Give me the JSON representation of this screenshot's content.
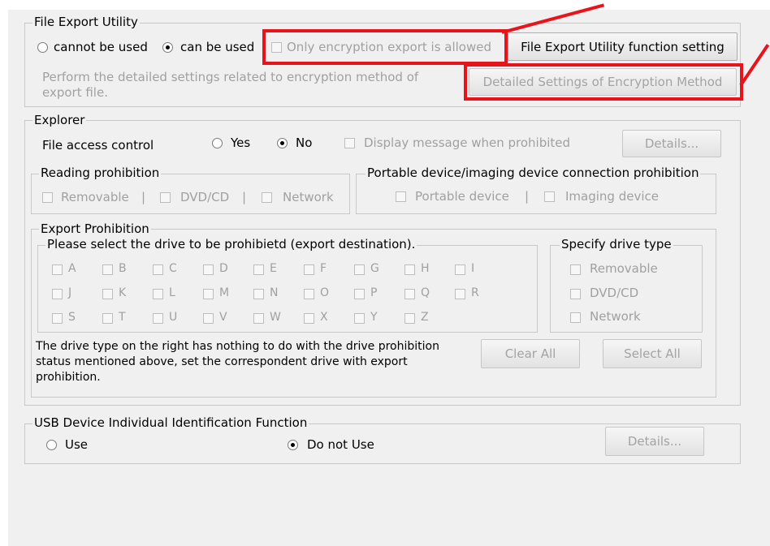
{
  "file_export": {
    "title": "File Export Utility",
    "radio_cannot": "cannot be used",
    "radio_can": "can be used",
    "encryption_only": "Only encryption export is allowed",
    "function_setting_button": "File Export Utility function setting",
    "description": "Perform the detailed settings related to encryption method of export file.",
    "encryption_method_button": "Detailed Settings of Encryption Method"
  },
  "explorer": {
    "title": "Explorer",
    "file_access_label": "File access control",
    "yes": "Yes",
    "no": "No",
    "display_message": "Display message when prohibited",
    "details_button": "Details...",
    "reading": {
      "title": "Reading prohibition",
      "removable": "Removable",
      "dvdcd": "DVD/CD",
      "network": "Network",
      "sep": "|"
    },
    "portable": {
      "title": "Portable device/imaging device connection prohibition",
      "portable_device": "Portable device",
      "imaging_device": "Imaging device",
      "sep": "|"
    },
    "export": {
      "title": "Export Prohibition",
      "drive_select_title": "Please select the drive to be prohibietd (export destination).",
      "drives": [
        "A",
        "B",
        "C",
        "D",
        "E",
        "F",
        "G",
        "H",
        "I",
        "J",
        "K",
        "L",
        "M",
        "N",
        "O",
        "P",
        "Q",
        "R",
        "S",
        "T",
        "U",
        "V",
        "W",
        "X",
        "Y",
        "Z"
      ],
      "drive_type_title": "Specify drive type",
      "type_removable": "Removable",
      "type_dvdcd": "DVD/CD",
      "type_network": "Network",
      "note": "The drive type on the right has nothing to do with the drive prohibition status mentioned above, set the correspondent drive with export prohibition.",
      "clear_all": "Clear All",
      "select_all": "Select All"
    }
  },
  "usb": {
    "title": "USB Device Individual Identification Function",
    "use": "Use",
    "do_not_use": "Do not Use",
    "details_button": "Details..."
  },
  "colors": {
    "highlight": "#e8141b",
    "panel": "#f0f0f0",
    "disabled_text": "#a0a0a0"
  }
}
